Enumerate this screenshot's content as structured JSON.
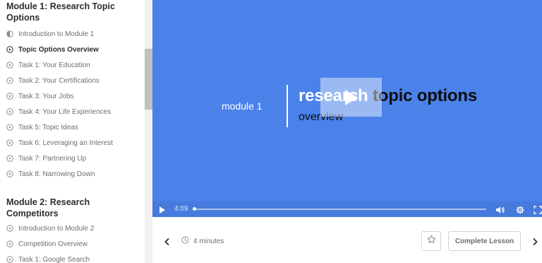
{
  "sidebar": {
    "modules": [
      {
        "title": "Module 1: Research Topic Options",
        "lessons": [
          {
            "label": "Introduction to Module 1",
            "icon": "half-circle-icon"
          },
          {
            "label": "Topic Options Overview",
            "icon": "play-circle-icon",
            "active": true
          },
          {
            "label": "Task 1: Your Education",
            "icon": "play-circle-icon"
          },
          {
            "label": "Task 2: Your Certifications",
            "icon": "play-circle-icon"
          },
          {
            "label": "Task 3: Your Jobs",
            "icon": "play-circle-icon"
          },
          {
            "label": "Task 4: Your Life Experiences",
            "icon": "play-circle-icon"
          },
          {
            "label": "Task 5: Topic Ideas",
            "icon": "play-circle-icon"
          },
          {
            "label": "Task 6: Leveraging an Interest",
            "icon": "play-circle-icon"
          },
          {
            "label": "Task 7: Partnering Up",
            "icon": "play-circle-icon"
          },
          {
            "label": "Task 8: Narrowing Down",
            "icon": "play-circle-icon"
          }
        ]
      },
      {
        "title": "Module 2: Research Competitors",
        "lessons": [
          {
            "label": "Introduction to Module 2",
            "icon": "play-circle-icon"
          },
          {
            "label": "Competition Overview",
            "icon": "play-circle-icon"
          },
          {
            "label": "Task 1: Google Search",
            "icon": "play-circle-icon"
          }
        ]
      }
    ]
  },
  "video": {
    "slide_module": "module 1",
    "slide_title_highlight": "research",
    "slide_title_rest": " topic options",
    "slide_subtitle": "overview",
    "current_time": "4:09",
    "progress_fraction": 0.0,
    "background_color": "#4a82ea"
  },
  "footer": {
    "duration": "4 minutes",
    "complete_label": "Complete Lesson"
  }
}
